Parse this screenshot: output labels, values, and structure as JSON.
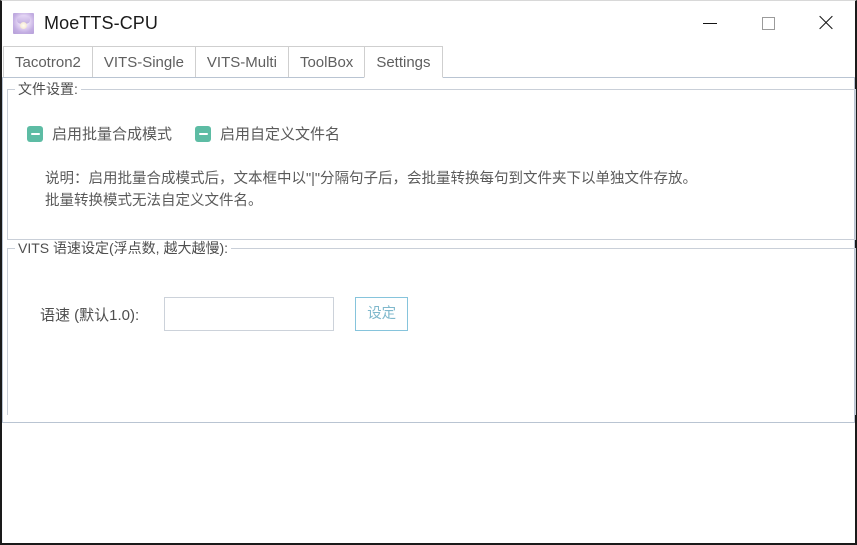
{
  "window": {
    "title": "MoeTTS-CPU",
    "icon": "app-avatar-icon",
    "controls": {
      "minimize": "minimize-icon",
      "maximize": "maximize-icon",
      "close": "close-icon"
    }
  },
  "tabs": [
    {
      "label": "Tacotron2",
      "active": false
    },
    {
      "label": "VITS-Single",
      "active": false
    },
    {
      "label": "VITS-Multi",
      "active": false
    },
    {
      "label": "ToolBox",
      "active": false
    },
    {
      "label": "Settings",
      "active": true
    }
  ],
  "file_settings": {
    "group_title": "文件设置:",
    "checkboxes": [
      {
        "label": "启用批量合成模式",
        "state": "indeterminate"
      },
      {
        "label": "启用自定义文件名",
        "state": "indeterminate"
      }
    ],
    "description": "说明：启用批量合成模式后，文本框中以\"|\"分隔句子后，会批量转换每句到文件夹下以单独文件存放。\n批量转换模式无法自定义文件名。"
  },
  "speed_settings": {
    "group_title": "VITS 语速设定(浮点数, 越大越慢):",
    "field_label": "语速 (默认1.0):",
    "input_value": "",
    "input_placeholder": "",
    "button_label": "设定"
  },
  "colors": {
    "checkbox_fill": "#5dbca4",
    "button_border": "#86c4dc",
    "button_text": "#7fb8cc",
    "group_border": "#c9cfd8",
    "panel_border": "#b9c4d2",
    "text": "#5a5a5a",
    "window_border": "#1a1a1a"
  }
}
